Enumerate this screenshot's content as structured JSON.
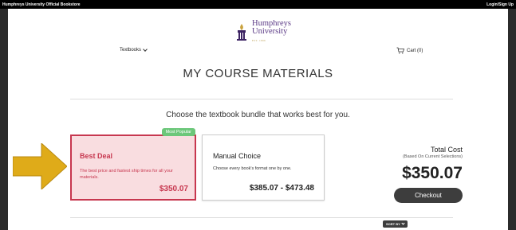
{
  "topbar": {
    "site_name": "Humphreys University Official Bookstore",
    "login": "Login/Sign Up"
  },
  "brand": {
    "name_line1": "Humphreys",
    "name_line2": "University",
    "tagline": "EST. 1896",
    "accent_color": "#5b3a86"
  },
  "nav": {
    "textbooks_label": "Textbooks",
    "cart_label": "Cart (0)"
  },
  "page": {
    "title": "MY COURSE MATERIALS",
    "prompt": "Choose the textbook bundle that works best for you."
  },
  "bundles": {
    "best": {
      "badge": "Most Popular",
      "title": "Best Deal",
      "description": "The best price and fastest ship times for all your materials.",
      "price": "$350.07",
      "color": "#c7374f"
    },
    "manual": {
      "title": "Manual Choice",
      "description": "Choose every book's format one by one.",
      "price": "$385.07 - $473.48"
    }
  },
  "summary": {
    "label": "Total Cost",
    "sublabel": "(Based On Current Selections)",
    "amount": "$350.07",
    "checkout_label": "Checkout"
  },
  "sort": {
    "label": "SORT BY"
  },
  "icons": {
    "logo": "university-torch-logo-icon",
    "cart": "cart-icon",
    "arrow": "yellow-arrow-icon"
  }
}
